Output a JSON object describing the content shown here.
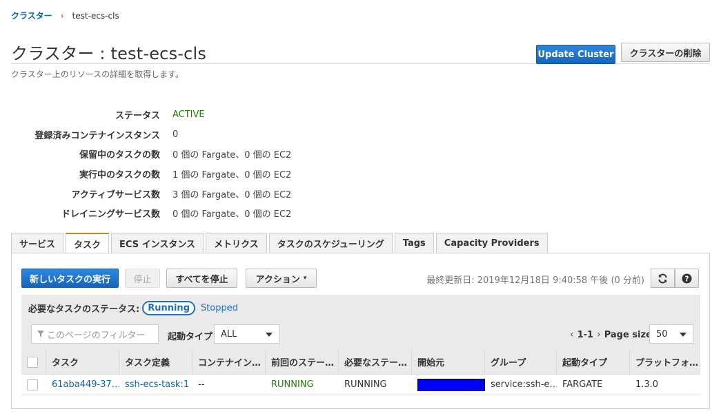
{
  "breadcrumb": {
    "root": "クラスター",
    "current": "test-ecs-cls"
  },
  "page": {
    "title": "クラスター : test-ecs-cls",
    "subtitle": "クラスター上のリソースの詳細を取得します。"
  },
  "header_buttons": {
    "update": "Update Cluster",
    "delete": "クラスターの削除"
  },
  "details": [
    {
      "label": "ステータス",
      "value": "ACTIVE",
      "status": true
    },
    {
      "label": "登録済みコンテナインスタンス",
      "value": "0"
    },
    {
      "label": "保留中のタスクの数",
      "value": "0 個の Fargate、0 個の EC2"
    },
    {
      "label": "実行中のタスクの数",
      "value": "1 個の Fargate、0 個の EC2"
    },
    {
      "label": "アクティブサービス数",
      "value": "3 個の Fargate、0 個の EC2"
    },
    {
      "label": "ドレイニングサービス数",
      "value": "0 個の Fargate、0 個の EC2"
    }
  ],
  "tabs": [
    {
      "label": "サービス"
    },
    {
      "label": "タスク",
      "selected": true
    },
    {
      "label": "ECS インスタンス"
    },
    {
      "label": "メトリクス"
    },
    {
      "label": "タスクのスケジューリング"
    },
    {
      "label": "Tags"
    },
    {
      "label": "Capacity Providers"
    }
  ],
  "toolbar": {
    "run_task": "新しいタスクの実行",
    "stop": "停止",
    "stop_all": "すべてを停止",
    "actions": "アクション",
    "last_updated": "最終更新日: 2019年12月18日 9:40:58 午後 (0 分前)",
    "refresh_icon": "refresh-icon",
    "help_icon": "help-icon"
  },
  "status_filter": {
    "label": "必要なタスクのステータス:",
    "running": "Running",
    "stopped": "Stopped"
  },
  "filter": {
    "placeholder": "このページのフィルター",
    "launch_type_label": "起動タイプ",
    "launch_type_value": "ALL",
    "page_range": "1-1",
    "page_size_label": "Page size",
    "page_size_value": "50"
  },
  "table": {
    "columns": [
      "タスク",
      "タスク定義",
      "コンテナイン…",
      "前回のステー…",
      "必要なステー…",
      "開始元",
      "グループ",
      "起動タイプ",
      "プラットフォ…"
    ],
    "rows": [
      {
        "task": "61aba449-37…",
        "task_def": "ssh-ecs-task:1",
        "container": "--",
        "last_status": "RUNNING",
        "desired_status": "RUNNING",
        "started_by": "",
        "group": "service:ssh-e…",
        "launch_type": "FARGATE",
        "platform": "1.3.0"
      }
    ]
  },
  "colors": {
    "primary": "#1f77d0",
    "link": "#0066c0",
    "active": "#1d8102",
    "tab_accent": "#e07a10",
    "redaction": "#0000ff"
  }
}
